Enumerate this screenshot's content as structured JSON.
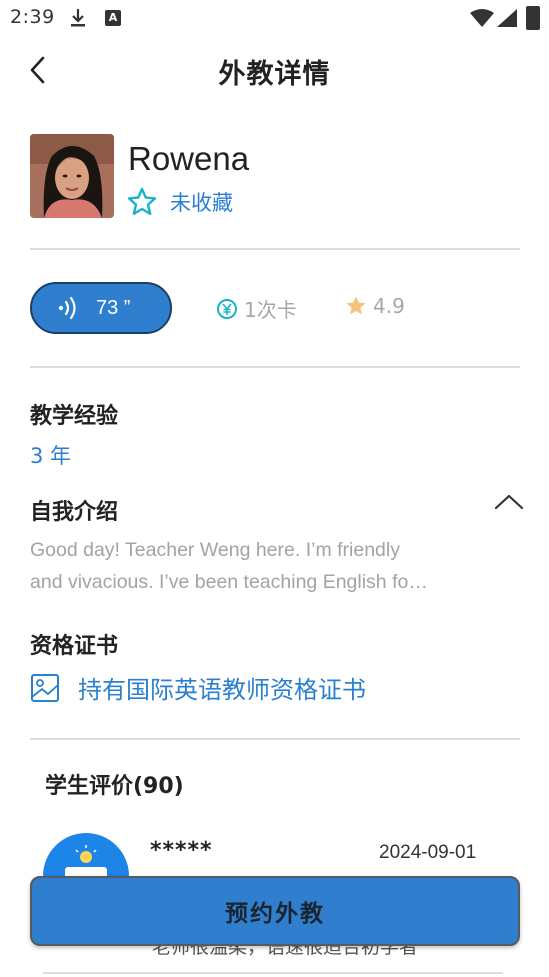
{
  "status_bar": {
    "time": "2:39",
    "a_icon_text": "A"
  },
  "header": {
    "title": "外教详情"
  },
  "teacher": {
    "name": "Rowena",
    "favorite_label": "未收藏"
  },
  "stats": {
    "audio_duration": "73 ”",
    "card_label": "1次卡",
    "rating": "4.9"
  },
  "sections": {
    "experience": {
      "title": "教学经验",
      "value": "3 年"
    },
    "intro": {
      "title": "自我介绍",
      "lines": [
        "Good day! Teacher Weng here. I’m friendly",
        "and vivacious. I’ve been teaching English fo…"
      ]
    },
    "certificate": {
      "title": "资格证书",
      "label": "持有国际英语教师资格证书"
    }
  },
  "reviews": {
    "title": "学生评价(90)",
    "items": [
      {
        "name": "*****",
        "date": "2024-09-01",
        "text": "老师很温柔，语速很适合初学者"
      }
    ]
  },
  "book_button": {
    "label": "预约外教"
  },
  "colors": {
    "accent": "#2f7fce",
    "link": "#2b7fd0",
    "teal_icon": "#19b3c4",
    "star": "#f5c27a"
  }
}
